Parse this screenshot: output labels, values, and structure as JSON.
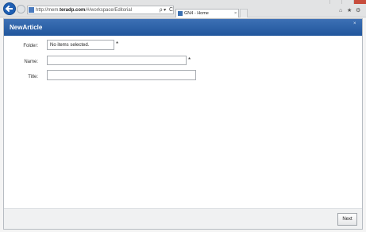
{
  "browser": {
    "address": {
      "url_prefix": "http://mem.",
      "url_domain": "teradp.com",
      "url_suffix": "/#/workspace/Editorial",
      "search_dropdown": "ρ ▾",
      "refresh": "C"
    },
    "tab": {
      "title": "GN4 - Home",
      "close": "×"
    },
    "toolbar": {
      "home": "⌂",
      "favorites": "★",
      "settings": "⚙"
    }
  },
  "dialog": {
    "title": "NewArticle",
    "close": "×",
    "fields": {
      "folder": {
        "label": "Folder:",
        "value": "No items selected.",
        "required_mark": "*"
      },
      "name": {
        "label": "Name:",
        "value": "",
        "required_mark": "*"
      },
      "title": {
        "label": "Title:",
        "value": ""
      }
    },
    "footer": {
      "next_label": "Next"
    }
  },
  "colors": {
    "header_accent": "#2a61a8",
    "browser_back": "#1e5fb4"
  }
}
